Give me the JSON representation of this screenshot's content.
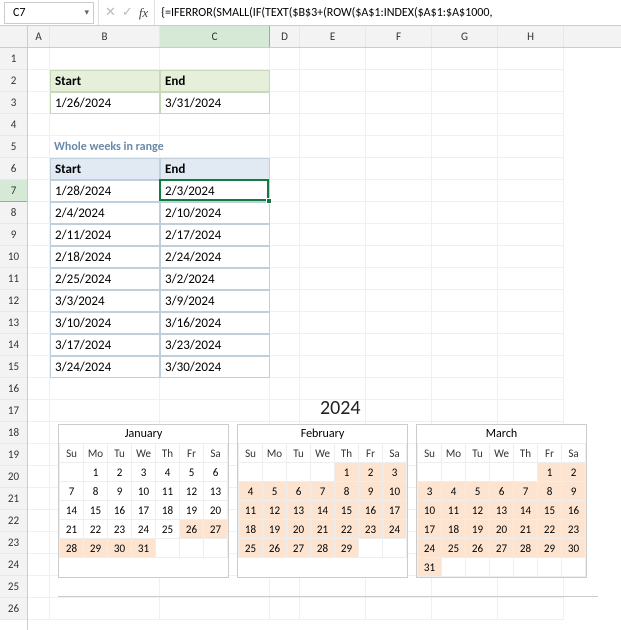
{
  "nameBox": "C7",
  "formula": "{=IFERROR(SMALL(IF(TEXT($B$3+(ROW($A$1:INDEX($A$1:$A$1000,",
  "colHeaders": [
    "A",
    "B",
    "C",
    "D",
    "E",
    "F",
    "G",
    "H"
  ],
  "rowHeaders": [
    "1",
    "2",
    "3",
    "4",
    "5",
    "6",
    "7",
    "8",
    "9",
    "10",
    "11",
    "12",
    "13",
    "14",
    "15",
    "16",
    "17",
    "18",
    "19",
    "20",
    "21",
    "22",
    "23",
    "24",
    "25",
    "26"
  ],
  "activeRow": 7,
  "activeCol": "C",
  "range1": {
    "startLabel": "Start",
    "endLabel": "End",
    "start": "1/26/2024",
    "end": "3/31/2024"
  },
  "weeksTitle": "Whole weeks in range",
  "weeks": {
    "startLabel": "Start",
    "endLabel": "End",
    "rows": [
      {
        "s": "1/28/2024",
        "e": "2/3/2024"
      },
      {
        "s": "2/4/2024",
        "e": "2/10/2024"
      },
      {
        "s": "2/11/2024",
        "e": "2/17/2024"
      },
      {
        "s": "2/18/2024",
        "e": "2/24/2024"
      },
      {
        "s": "2/25/2024",
        "e": "3/2/2024"
      },
      {
        "s": "3/3/2024",
        "e": "3/9/2024"
      },
      {
        "s": "3/10/2024",
        "e": "3/16/2024"
      },
      {
        "s": "3/17/2024",
        "e": "3/23/2024"
      },
      {
        "s": "3/24/2024",
        "e": "3/30/2024"
      }
    ]
  },
  "year": "2024",
  "dow": [
    "Su",
    "Mo",
    "Tu",
    "We",
    "Th",
    "Fr",
    "Sa"
  ],
  "months": [
    {
      "name": "January",
      "offset": 1,
      "days": 31,
      "hl": [
        26,
        27,
        28,
        29,
        30,
        31
      ]
    },
    {
      "name": "February",
      "offset": 4,
      "days": 29,
      "hl": [
        1,
        2,
        3,
        4,
        5,
        6,
        7,
        8,
        9,
        10,
        11,
        12,
        13,
        14,
        15,
        16,
        17,
        18,
        19,
        20,
        21,
        22,
        23,
        24,
        25,
        26,
        27,
        28,
        29
      ]
    },
    {
      "name": "March",
      "offset": 5,
      "days": 31,
      "hl": [
        1,
        2,
        3,
        4,
        5,
        6,
        7,
        8,
        9,
        10,
        11,
        12,
        13,
        14,
        15,
        16,
        17,
        18,
        19,
        20,
        21,
        22,
        23,
        24,
        25,
        26,
        27,
        28,
        29,
        30,
        31
      ]
    }
  ]
}
